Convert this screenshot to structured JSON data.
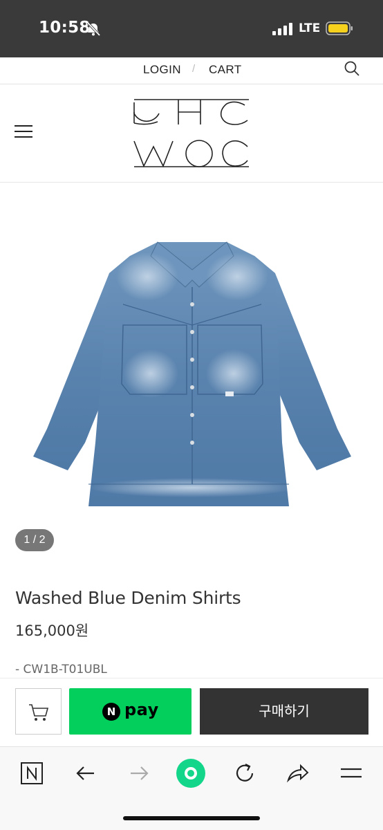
{
  "status_bar": {
    "time": "10:58",
    "network": "LTE",
    "battery_color": "#f5d01c",
    "icons": [
      "bell-muted-icon",
      "signal-icon",
      "battery-icon"
    ]
  },
  "util_bar": {
    "login": "LOGIN",
    "separator": "/",
    "cart": "CART",
    "search_icon": "search-icon"
  },
  "header": {
    "menu_icon": "hamburger-menu-icon",
    "logo_alt": "CHC WOC"
  },
  "product": {
    "image": "washed-blue-denim-shirt-photo",
    "pager": "1 / 2",
    "name": "Washed Blue Denim Shirts",
    "price": "165,000원",
    "code": "- CW1B-T01UBL"
  },
  "actions": {
    "cart_icon": "cart-icon",
    "npay_badge": "N",
    "npay_label": "pay",
    "npay_color": "#03cf5d",
    "buy_label": "구매하기"
  },
  "browser_bar": {
    "icons": [
      "naver-n-icon",
      "back-arrow-icon",
      "forward-arrow-icon",
      "green-dot-icon",
      "refresh-icon",
      "share-icon",
      "menu-lines-icon"
    ],
    "accent": "#14d68b"
  }
}
